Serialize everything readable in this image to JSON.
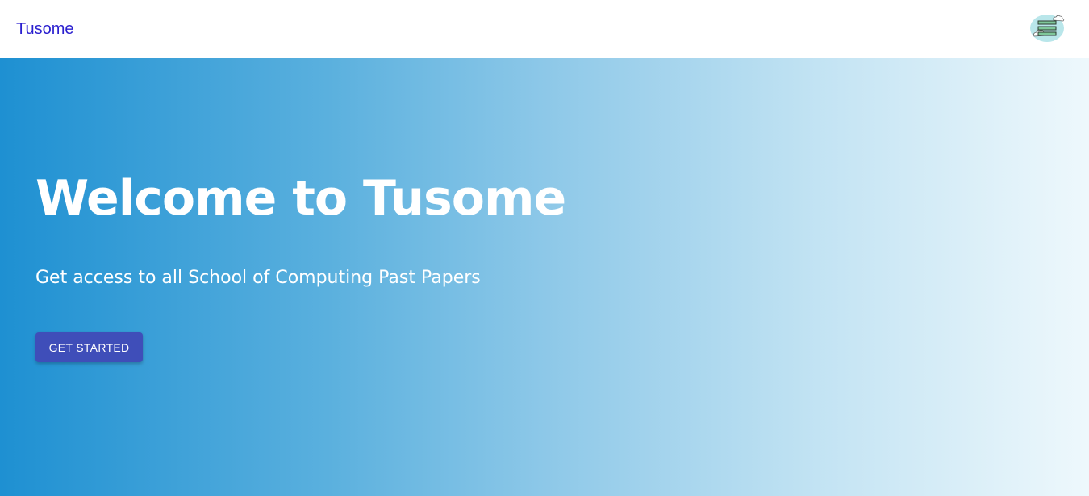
{
  "navbar": {
    "brand": "Tusome",
    "menu_icon": "hamburger-menu-icon"
  },
  "hero": {
    "title": "Welcome to Tusome",
    "subtitle": "Get access to all School of Computing Past Papers",
    "cta_label": "GET STARTED"
  },
  "colors": {
    "brand_text": "#2a1fcf",
    "cta_background": "#3f4eb9",
    "hero_gradient_start": "#1e90d2",
    "hero_gradient_end": "#eef8fc"
  }
}
